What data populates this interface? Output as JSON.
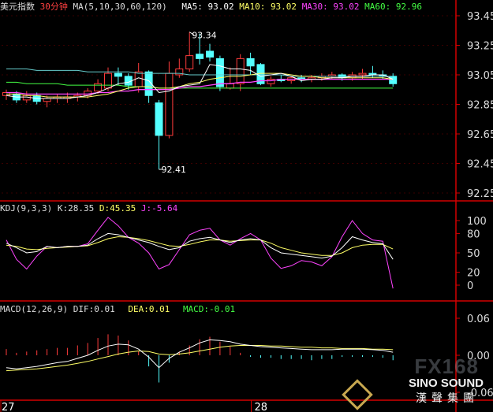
{
  "header": {
    "symbol": "美元指数",
    "period": "30分钟",
    "ma_label": "MA(5,10,30,60,120)",
    "ma5": "MA5: 93.02",
    "ma10": "MA10: 93.02",
    "ma30": "MA30: 93.02",
    "ma60": "MA60: 92.96"
  },
  "kdj_header": {
    "label": "KDJ(9,3,3)",
    "k": "K:28.35",
    "d": "D:45.35",
    "j": "J:-5.64"
  },
  "macd_header": {
    "label": "MACD(12,26,9)",
    "dif": "DIF:0.01",
    "dea": "DEA:0.01",
    "macd": "MACD:-0.01"
  },
  "colors": {
    "up": "#ff3b3b",
    "down": "#54ffff",
    "ma5": "#ffffff",
    "ma10": "#ffff66",
    "ma30": "#ff44ff",
    "ma60": "#44ff44",
    "ma120": "#66cccc",
    "separator": "#d40000"
  },
  "chart_data": {
    "type": "candlestick",
    "price_axis": {
      "ticks": [
        "93.45",
        "93.25",
        "93.05",
        "92.85",
        "92.65",
        "92.45",
        "92.25"
      ],
      "range": [
        92.25,
        93.45
      ]
    },
    "kdj_axis": {
      "ticks": [
        "100",
        "80",
        "50",
        "20",
        "0"
      ]
    },
    "macd_axis": {
      "ticks": [
        "0.06",
        "0.00",
        "-0.06"
      ]
    },
    "x_labels": [
      {
        "label": "27",
        "index": 0
      },
      {
        "label": "28",
        "index": 25
      }
    ],
    "annotations": {
      "high": "93.34",
      "low": "92.41"
    },
    "candles": [
      {
        "o": 92.91,
        "h": 92.95,
        "l": 92.88,
        "c": 92.93
      },
      {
        "o": 92.92,
        "h": 92.94,
        "l": 92.86,
        "c": 92.88
      },
      {
        "o": 92.88,
        "h": 92.94,
        "l": 92.86,
        "c": 92.91
      },
      {
        "o": 92.91,
        "h": 92.93,
        "l": 92.85,
        "c": 92.87
      },
      {
        "o": 92.87,
        "h": 92.91,
        "l": 92.83,
        "c": 92.89
      },
      {
        "o": 92.89,
        "h": 92.92,
        "l": 92.86,
        "c": 92.9
      },
      {
        "o": 92.89,
        "h": 92.93,
        "l": 92.86,
        "c": 92.9
      },
      {
        "o": 92.9,
        "h": 92.93,
        "l": 92.87,
        "c": 92.91
      },
      {
        "o": 92.91,
        "h": 92.96,
        "l": 92.89,
        "c": 92.94
      },
      {
        "o": 92.94,
        "h": 93.02,
        "l": 92.92,
        "c": 92.99
      },
      {
        "o": 92.96,
        "h": 93.1,
        "l": 92.94,
        "c": 93.06
      },
      {
        "o": 93.06,
        "h": 93.1,
        "l": 92.98,
        "c": 93.04
      },
      {
        "o": 93.04,
        "h": 93.06,
        "l": 92.95,
        "c": 92.98
      },
      {
        "o": 92.97,
        "h": 93.13,
        "l": 92.93,
        "c": 93.07
      },
      {
        "o": 93.07,
        "h": 93.08,
        "l": 92.86,
        "c": 92.91
      },
      {
        "o": 92.86,
        "h": 92.88,
        "l": 92.41,
        "c": 92.64
      },
      {
        "o": 92.64,
        "h": 93.14,
        "l": 92.62,
        "c": 93.06
      },
      {
        "o": 93.05,
        "h": 93.16,
        "l": 93.03,
        "c": 93.09
      },
      {
        "o": 93.09,
        "h": 93.34,
        "l": 93.07,
        "c": 93.18
      },
      {
        "o": 93.19,
        "h": 93.33,
        "l": 93.12,
        "c": 93.16
      },
      {
        "o": 93.21,
        "h": 93.26,
        "l": 93.14,
        "c": 93.17
      },
      {
        "o": 93.16,
        "h": 93.18,
        "l": 92.94,
        "c": 92.97
      },
      {
        "o": 92.96,
        "h": 93.1,
        "l": 92.95,
        "c": 92.99
      },
      {
        "o": 92.99,
        "h": 93.19,
        "l": 92.94,
        "c": 93.16
      },
      {
        "o": 93.16,
        "h": 93.2,
        "l": 93.05,
        "c": 93.11
      },
      {
        "o": 93.12,
        "h": 93.13,
        "l": 92.98,
        "c": 92.99
      },
      {
        "o": 92.99,
        "h": 93.04,
        "l": 92.97,
        "c": 93.02
      },
      {
        "o": 93.02,
        "h": 93.05,
        "l": 93.0,
        "c": 93.01
      },
      {
        "o": 93.01,
        "h": 93.04,
        "l": 92.99,
        "c": 93.03
      },
      {
        "o": 93.03,
        "h": 93.05,
        "l": 93.0,
        "c": 93.02
      },
      {
        "o": 93.02,
        "h": 93.05,
        "l": 93.0,
        "c": 93.03
      },
      {
        "o": 93.03,
        "h": 93.06,
        "l": 93.01,
        "c": 93.04
      },
      {
        "o": 93.04,
        "h": 93.07,
        "l": 93.02,
        "c": 93.05
      },
      {
        "o": 93.05,
        "h": 93.06,
        "l": 93.01,
        "c": 93.03
      },
      {
        "o": 93.03,
        "h": 93.07,
        "l": 93.01,
        "c": 93.05
      },
      {
        "o": 93.05,
        "h": 93.09,
        "l": 93.02,
        "c": 93.06
      },
      {
        "o": 93.06,
        "h": 93.11,
        "l": 93.03,
        "c": 93.05
      },
      {
        "o": 93.05,
        "h": 93.08,
        "l": 93.02,
        "c": 93.04
      },
      {
        "o": 93.04,
        "h": 93.06,
        "l": 92.97,
        "c": 92.99
      }
    ],
    "ma": {
      "ma5": [
        92.91,
        92.9,
        92.9,
        92.89,
        92.89,
        92.89,
        92.89,
        92.9,
        92.91,
        92.93,
        92.96,
        92.99,
        93.0,
        93.03,
        93.01,
        92.93,
        92.94,
        92.97,
        92.98,
        92.99,
        93.12,
        93.11,
        93.09,
        93.09,
        93.08,
        93.04,
        93.05,
        93.06,
        93.04,
        93.01,
        93.02,
        93.02,
        93.03,
        93.03,
        93.04,
        93.04,
        93.05,
        93.05,
        93.02
      ],
      "ma10": [
        92.92,
        92.92,
        92.91,
        92.91,
        92.9,
        92.9,
        92.9,
        92.9,
        92.9,
        92.91,
        92.92,
        92.94,
        92.96,
        92.97,
        92.97,
        92.96,
        92.96,
        92.97,
        92.99,
        93.0,
        93.02,
        93.03,
        93.04,
        93.04,
        93.05,
        93.06,
        93.06,
        93.06,
        93.05,
        93.04,
        93.04,
        93.03,
        93.03,
        93.03,
        93.03,
        93.03,
        93.03,
        93.03,
        93.02
      ],
      "ma30": [
        92.93,
        92.93,
        92.92,
        92.92,
        92.92,
        92.92,
        92.92,
        92.92,
        92.92,
        92.93,
        92.93,
        92.94,
        92.94,
        92.95,
        92.95,
        92.95,
        92.95,
        92.96,
        92.97,
        92.97,
        92.98,
        92.99,
        92.99,
        93.0,
        93.0,
        93.01,
        93.01,
        93.02,
        93.02,
        93.02,
        93.02,
        93.02,
        93.02,
        93.02,
        93.02,
        93.02,
        93.02,
        93.02,
        93.02
      ],
      "ma60": [
        93.0,
        93.0,
        92.99,
        92.99,
        92.99,
        92.99,
        92.98,
        92.98,
        92.98,
        92.98,
        92.98,
        92.98,
        92.97,
        92.97,
        92.97,
        92.96,
        92.96,
        92.96,
        92.96,
        92.96,
        92.96,
        92.96,
        92.96,
        92.96,
        92.96,
        92.96,
        92.96,
        92.96,
        92.96,
        92.96,
        92.96,
        92.96,
        92.96,
        92.96,
        92.96,
        92.96,
        92.96,
        92.96,
        92.96
      ],
      "ma120": [
        93.09,
        93.09,
        93.09,
        93.08,
        93.08,
        93.08,
        93.08,
        93.08,
        93.07,
        93.07,
        93.07,
        93.07,
        93.07,
        93.06,
        93.06,
        93.06,
        93.06,
        93.06,
        93.05,
        93.05,
        93.05,
        93.05,
        93.05,
        93.05,
        93.05,
        93.05,
        93.05,
        93.05,
        93.04,
        93.04,
        93.04,
        93.04,
        93.04,
        93.04,
        93.04,
        93.04,
        93.04,
        93.04,
        93.04
      ]
    },
    "kdj": {
      "k": [
        65,
        58,
        50,
        52,
        60,
        58,
        60,
        60,
        62,
        72,
        80,
        78,
        74,
        70,
        66,
        60,
        55,
        58,
        68,
        72,
        74,
        70,
        66,
        70,
        72,
        70,
        58,
        50,
        48,
        46,
        44,
        42,
        45,
        58,
        75,
        70,
        66,
        64,
        40
      ],
      "d": [
        62,
        60,
        56,
        55,
        57,
        58,
        59,
        60,
        61,
        66,
        72,
        75,
        74,
        72,
        69,
        65,
        61,
        60,
        63,
        67,
        70,
        70,
        68,
        69,
        70,
        70,
        65,
        58,
        54,
        50,
        48,
        46,
        46,
        50,
        58,
        62,
        63,
        63,
        56
      ],
      "j": [
        70,
        40,
        25,
        45,
        60,
        58,
        60,
        60,
        64,
        85,
        105,
        92,
        74,
        65,
        50,
        25,
        32,
        55,
        78,
        85,
        88,
        70,
        62,
        72,
        80,
        70,
        42,
        26,
        30,
        38,
        36,
        30,
        44,
        75,
        100,
        80,
        70,
        68,
        -6
      ]
    },
    "macd": {
      "dif": [
        -0.02,
        -0.022,
        -0.02,
        -0.018,
        -0.015,
        -0.012,
        -0.01,
        -0.005,
        0.0,
        0.008,
        0.015,
        0.018,
        0.017,
        0.01,
        -0.003,
        -0.02,
        -0.005,
        0.005,
        0.012,
        0.02,
        0.025,
        0.024,
        0.022,
        0.018,
        0.016,
        0.014,
        0.013,
        0.012,
        0.011,
        0.01,
        0.009,
        0.009,
        0.009,
        0.01,
        0.01,
        0.01,
        0.009,
        0.008,
        0.005
      ],
      "dea": [
        -0.025,
        -0.024,
        -0.023,
        -0.022,
        -0.02,
        -0.018,
        -0.016,
        -0.013,
        -0.01,
        -0.006,
        -0.002,
        0.002,
        0.005,
        0.007,
        0.006,
        0.002,
        0.001,
        0.002,
        0.004,
        0.007,
        0.01,
        0.013,
        0.015,
        0.016,
        0.016,
        0.016,
        0.015,
        0.015,
        0.014,
        0.013,
        0.013,
        0.012,
        0.012,
        0.011,
        0.011,
        0.011,
        0.01,
        0.01,
        0.009
      ],
      "hist": [
        0.01,
        0.004,
        0.006,
        0.008,
        0.01,
        0.012,
        0.012,
        0.016,
        0.02,
        0.028,
        0.034,
        0.032,
        0.024,
        0.006,
        -0.018,
        -0.044,
        -0.012,
        0.006,
        0.016,
        0.026,
        0.03,
        0.022,
        0.014,
        0.004,
        0.0,
        -0.004,
        -0.004,
        -0.006,
        -0.006,
        -0.006,
        -0.008,
        -0.006,
        -0.006,
        -0.002,
        -0.002,
        -0.002,
        -0.002,
        -0.004,
        -0.008
      ]
    }
  },
  "watermark": {
    "fx": "FX168",
    "brand": "SINO SOUND",
    "cn": "漢聲集團"
  }
}
